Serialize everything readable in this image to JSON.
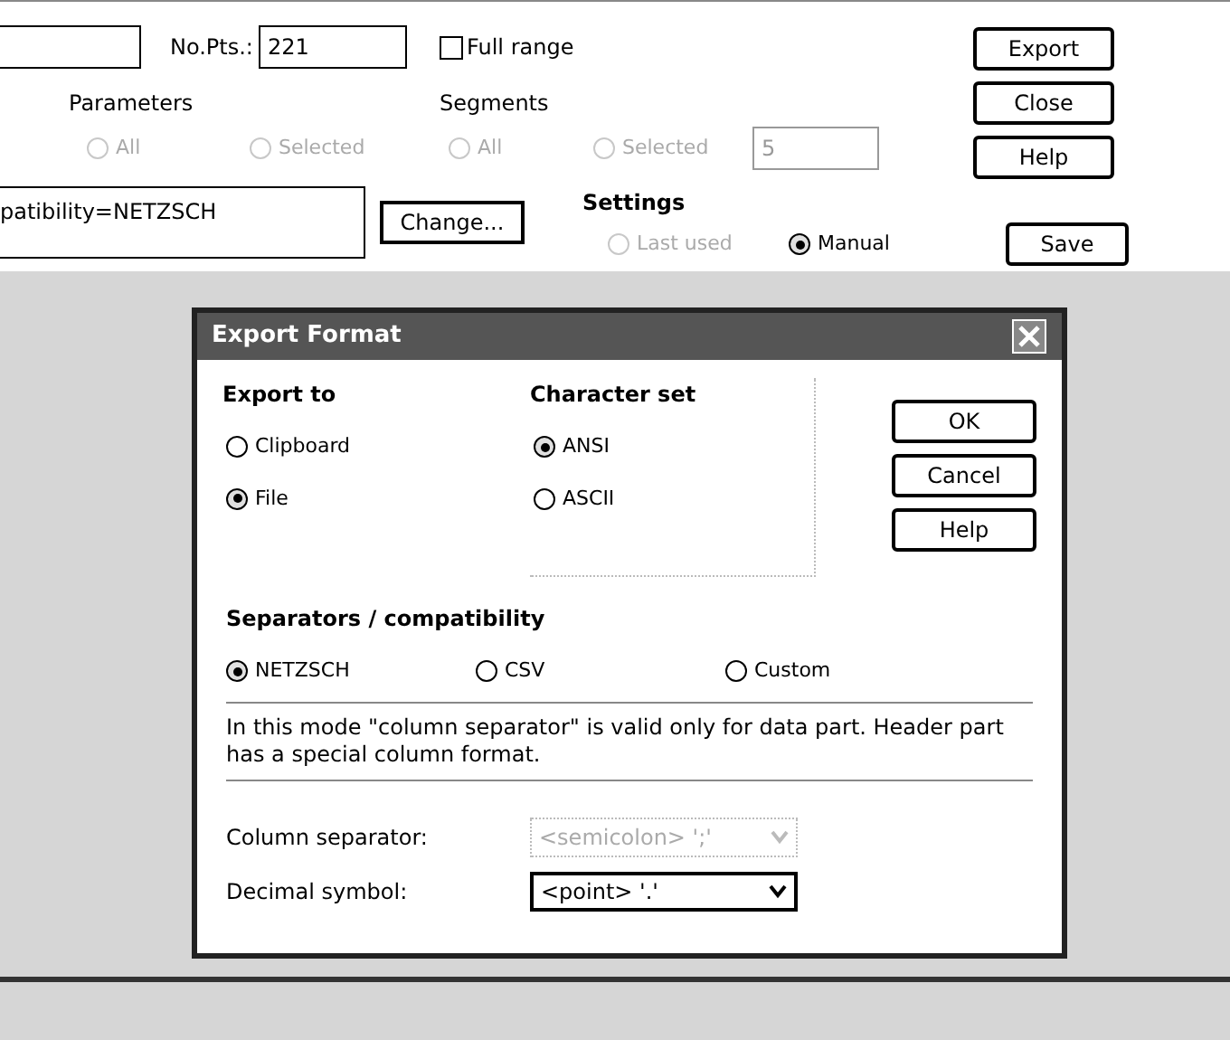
{
  "top_panel": {
    "points": {
      "label": "No.Pts.:",
      "value": "221"
    },
    "full_range": {
      "label": "Full range",
      "checked": false
    },
    "parameters": {
      "label": "Parameters",
      "options": [
        {
          "label": "All",
          "selected": false,
          "disabled": true
        },
        {
          "label": "Selected",
          "selected": false,
          "disabled": true
        }
      ]
    },
    "segments": {
      "label": "Segments",
      "options": [
        {
          "label": "All",
          "selected": false,
          "disabled": true
        },
        {
          "label": "Selected",
          "selected": false,
          "disabled": true
        }
      ],
      "count_value": "5"
    },
    "format_field": {
      "value": "patibility=NETZSCH"
    },
    "change_button": "Change...",
    "settings": {
      "label": "Settings",
      "options": [
        {
          "label": "Last used",
          "selected": false,
          "disabled": true
        },
        {
          "label": "Manual",
          "selected": true,
          "disabled": false
        }
      ]
    },
    "buttons": [
      "Export",
      "Close",
      "Help"
    ],
    "save_button": "Save"
  },
  "dialog": {
    "title": "Export Format",
    "export_to": {
      "label": "Export to",
      "options": [
        {
          "label": "Clipboard",
          "selected": false
        },
        {
          "label": "File",
          "selected": true
        }
      ]
    },
    "character_set": {
      "label": "Character set",
      "options": [
        {
          "label": "ANSI",
          "selected": true
        },
        {
          "label": "ASCII",
          "selected": false
        }
      ]
    },
    "buttons": [
      "OK",
      "Cancel",
      "Help"
    ],
    "separators": {
      "label": "Separators / compatibility",
      "options": [
        {
          "label": "NETZSCH",
          "selected": true
        },
        {
          "label": "CSV",
          "selected": false
        },
        {
          "label": "Custom",
          "selected": false
        }
      ]
    },
    "note": "In this mode \"column separator\" is valid only for data part. Header part has a special column format.",
    "fields": [
      {
        "label": "Column separator:",
        "value": "<semicolon> ';'",
        "disabled": true
      },
      {
        "label": "Decimal symbol:",
        "value": "<point> '.'",
        "disabled": false
      }
    ]
  }
}
